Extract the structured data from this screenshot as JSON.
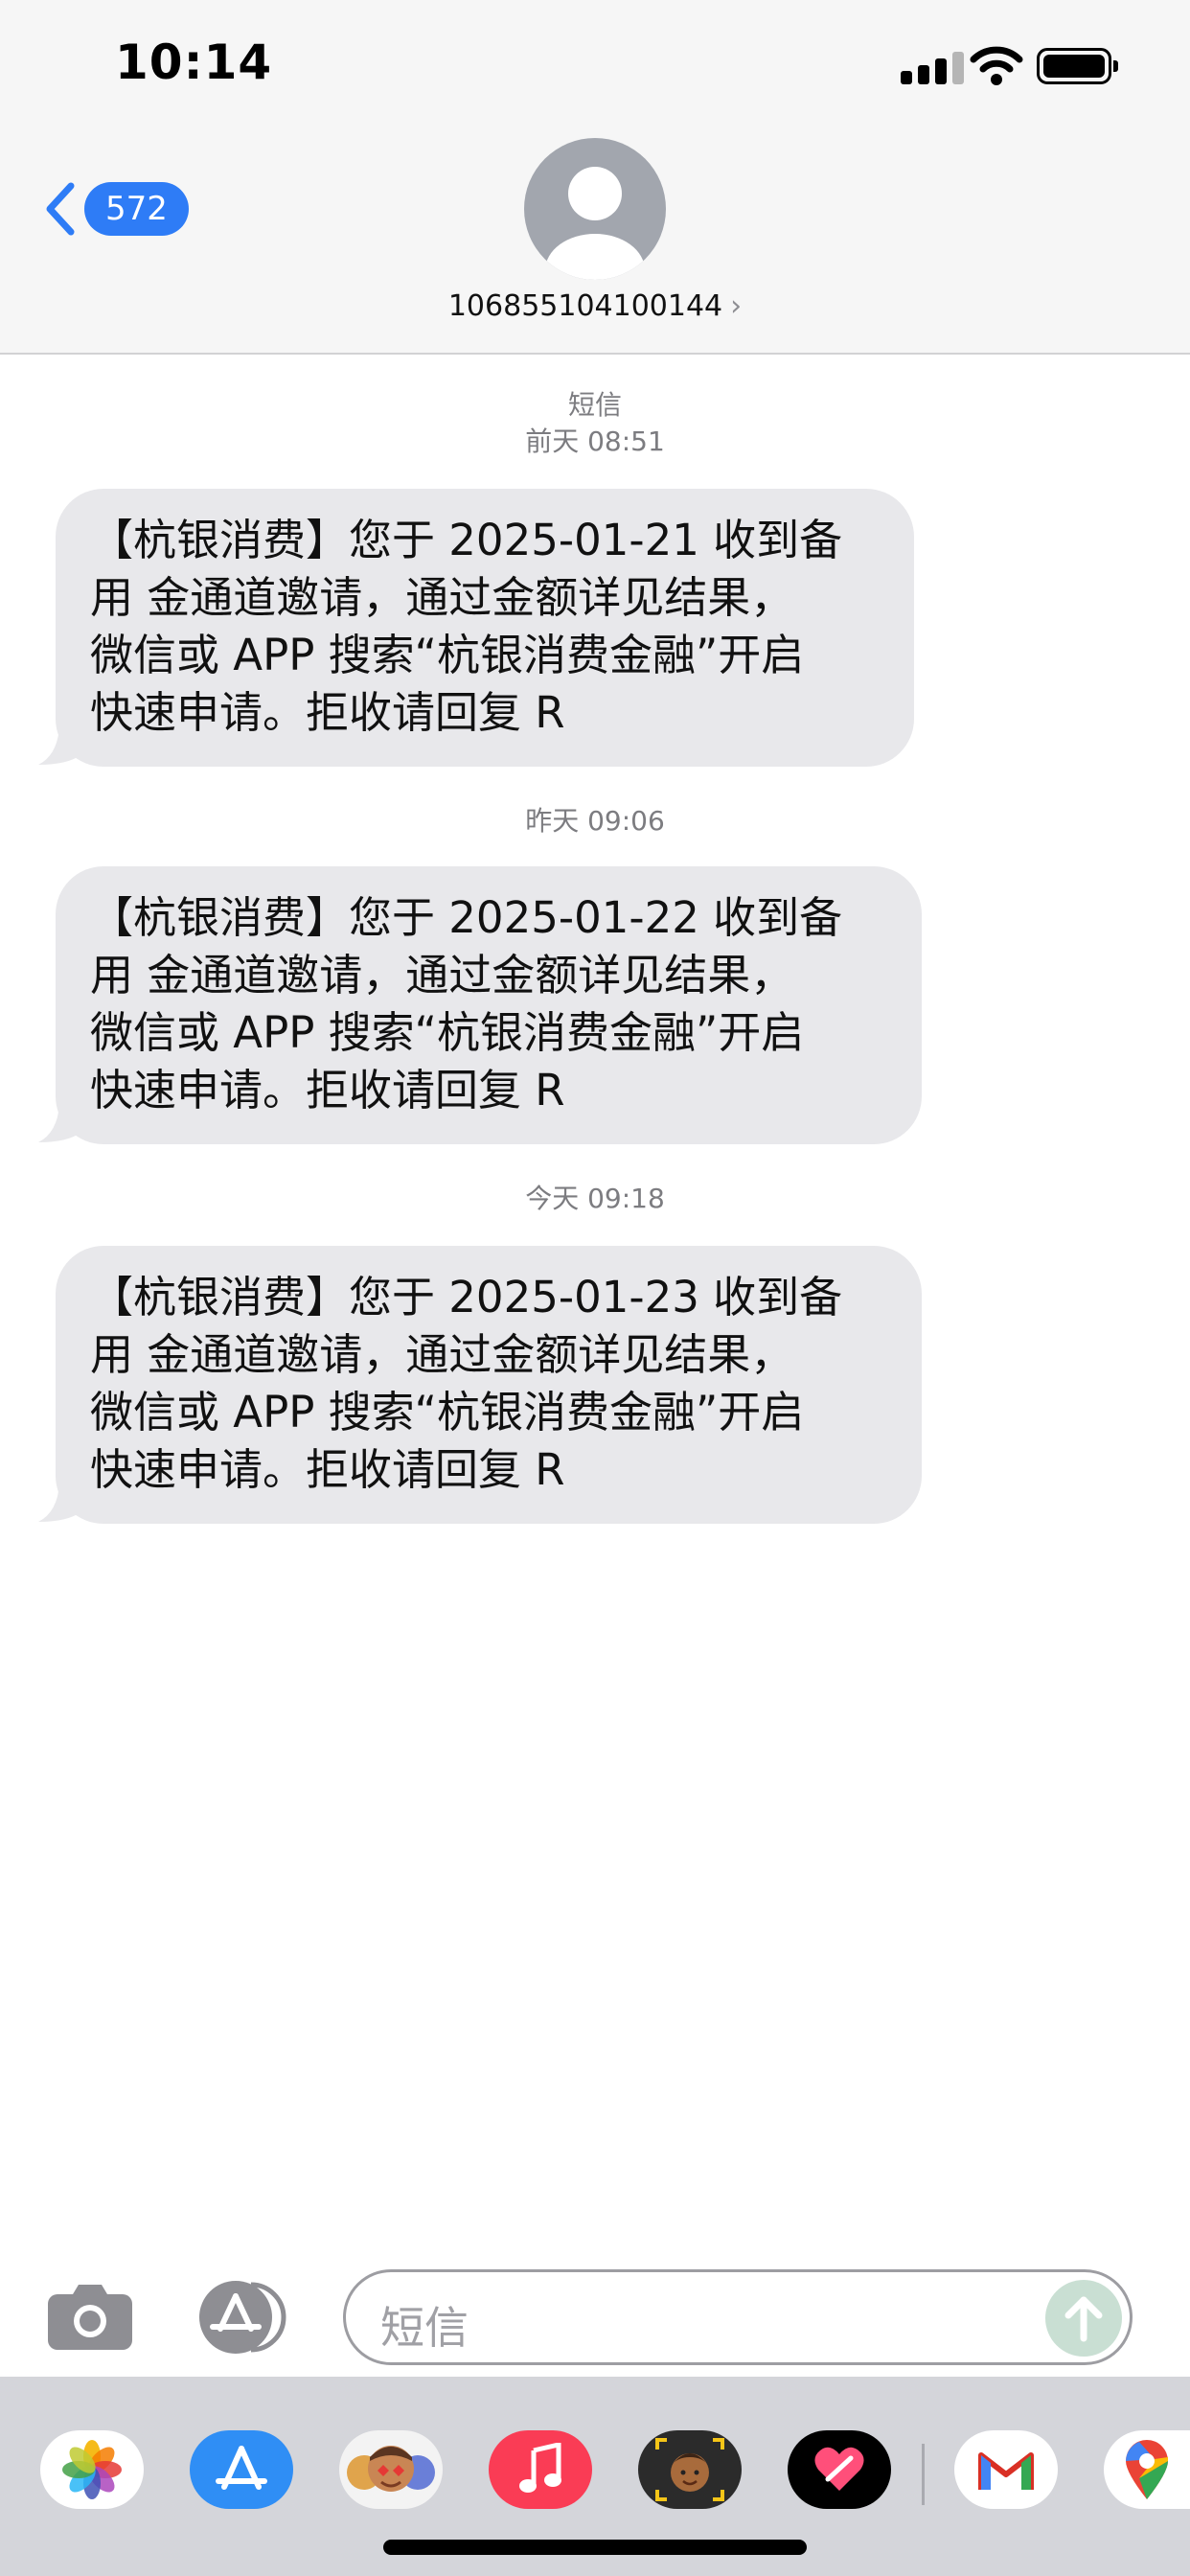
{
  "status_bar": {
    "time": "10:14"
  },
  "header": {
    "back_count": "572",
    "contact_name": "106855104100144",
    "chevron": "›"
  },
  "conversation": {
    "service_label": "短信",
    "messages": [
      {
        "timestamp": "前天 08:51",
        "lines": [
          "【杭银消费】您于 2025-01-21 收到备",
          "用 金通道邀请，通过金额详见结果，",
          "微信或 APP 搜索“杭银消费金融”开启",
          "快速申请。拒收请回复 R"
        ]
      },
      {
        "timestamp": "昨天 09:06",
        "lines": [
          "【杭银消费】您于 2025-01-22 收到备",
          "用 金通道邀请，通过金额详见结果，",
          "微信或 APP 搜索“杭银消费金融”开启",
          "快速申请。拒收请回复 R"
        ]
      },
      {
        "timestamp": "今天 09:18",
        "lines": [
          "【杭银消费】您于 2025-01-23 收到备",
          "用 金通道邀请，通过金额详见结果，",
          "微信或 APP 搜索“杭银消费金融”开启",
          "快速申请。拒收请回复 R"
        ]
      }
    ]
  },
  "compose": {
    "placeholder": "短信"
  },
  "app_drawer": {
    "apps": [
      "photos-icon",
      "app-store-icon",
      "memoji-stickers-icon",
      "music-icon",
      "memoji-icon",
      "digital-touch-icon",
      "gmail-icon",
      "maps-icon"
    ]
  },
  "colors": {
    "accent": "#2e7cf6",
    "bubble": "#e8e8eb",
    "header_bg": "#f6f6f6",
    "drawer_bg": "#d4d5da"
  }
}
